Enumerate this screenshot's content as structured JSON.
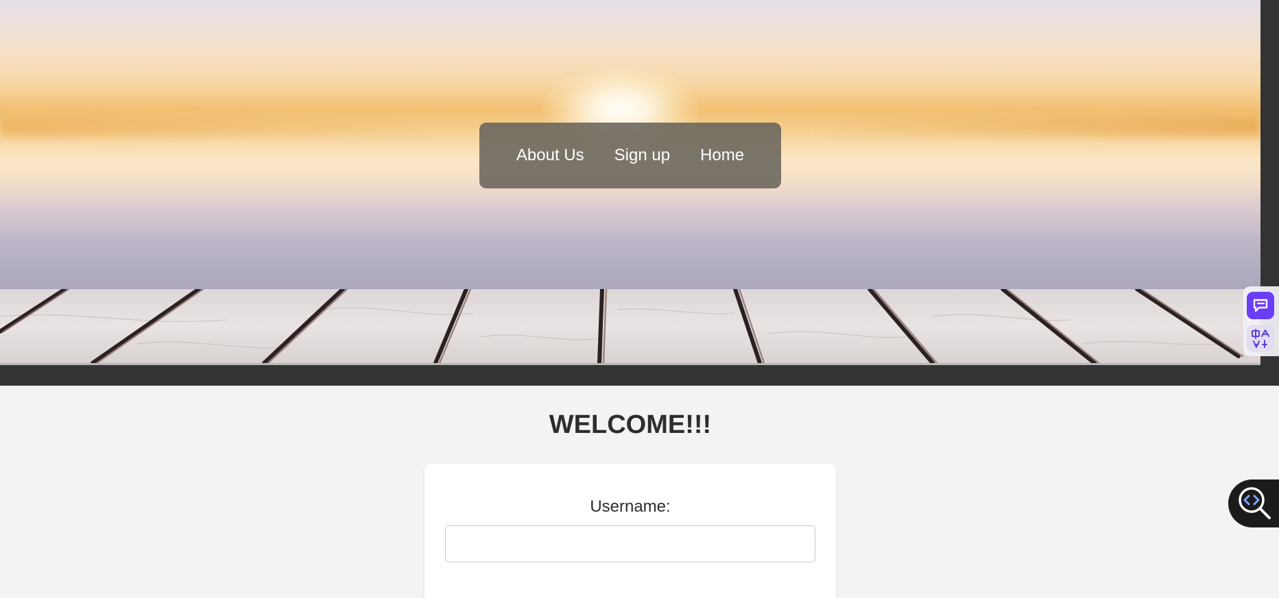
{
  "nav": {
    "items": [
      {
        "label": "About Us"
      },
      {
        "label": "Sign up"
      },
      {
        "label": "Home"
      }
    ]
  },
  "main": {
    "heading": "WELCOME!!!",
    "form": {
      "username_label": "Username:",
      "username_value": "",
      "username_placeholder": ""
    }
  },
  "widgets": {
    "chat_icon": "chat-bubble-icon",
    "translate_icon": "translate-icon",
    "inspect_icon": "code-search-icon",
    "accent_color": "#6a3ef5"
  },
  "colors": {
    "hero_frame": "#333333",
    "page_background": "#f3f3f3",
    "nav_background": "#69645c",
    "heading_text": "#2d2d2d"
  }
}
